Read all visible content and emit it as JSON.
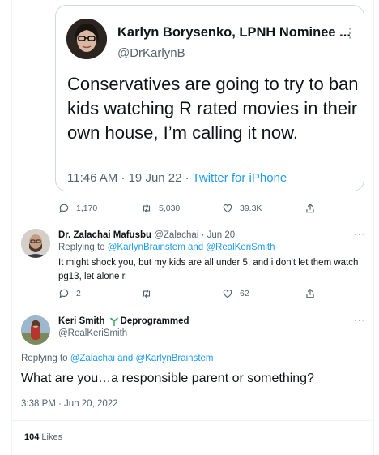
{
  "quoted_tweet": {
    "author_name": "Karlyn Borysenko, LPNH Nominee ...",
    "handle": "@DrKarlynB",
    "more": "⋮",
    "text": "Conservatives are going to try to ban kids watching R rated movies in their own house, I’m calling it now.",
    "timestamp": "11:46 AM · 19 Jun 22 · ",
    "source": "Twitter for iPhone",
    "actions": {
      "replies": "1,170",
      "retweets": "5,030",
      "likes": "39.3K"
    }
  },
  "reply_tweet": {
    "author_name": "Dr. Zalachai Mafusbu",
    "handle_time": "@Zalachai · Jun 20",
    "more": "···",
    "replying_prefix": "Replying to ",
    "replying_to": "@KarlynBrainstem and @RealKeriSmith",
    "text": "It might shock you, but my kids are all under 5, and i don't let them watch pg13, let alone r.",
    "actions": {
      "replies": "2",
      "retweets": "",
      "likes": "62"
    }
  },
  "main_tweet": {
    "author_name": "Keri Smith",
    "author_suffix": "Deprogrammed",
    "handle": "@RealKeriSmith",
    "more": "···",
    "replying_prefix": "Replying to ",
    "replying_to": "@Zalachai and @KarlynBrainstem",
    "text": "What are you…a responsible parent or something?",
    "timestamp": "3:38 PM · Jun 20, 2022",
    "likes_count": "104",
    "likes_label": "Likes"
  },
  "colors": {
    "link": "#1d9bf0",
    "text": "#0f1419",
    "muted": "#536471",
    "border": "#cfd9de",
    "sprout": "#2e9e4f"
  },
  "icons": [
    "reply-icon",
    "retweet-icon",
    "like-icon",
    "share-icon",
    "sprout-icon",
    "more-icon"
  ]
}
